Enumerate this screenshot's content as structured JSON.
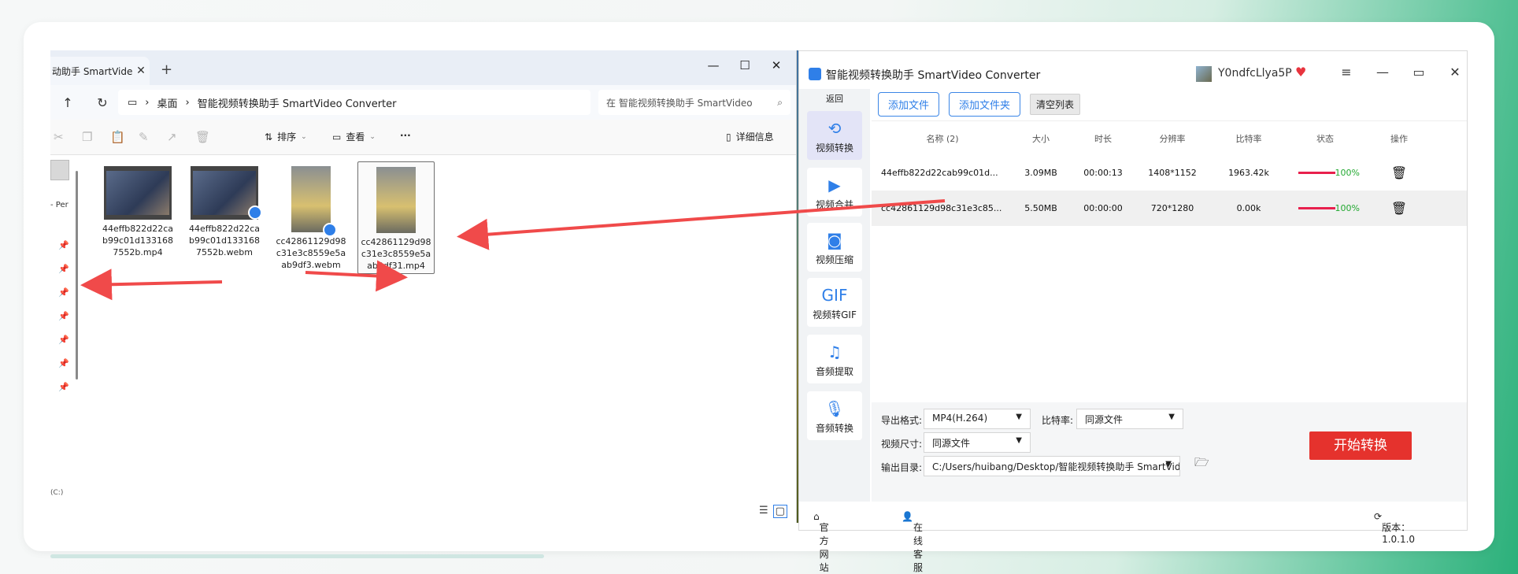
{
  "explorer": {
    "tab_title": "动助手 SmartVideo",
    "tab_close": "✕",
    "new_tab": "+",
    "window": {
      "minimize": "—",
      "maximize": "☐",
      "close": "✕"
    },
    "nav": {
      "up": "↑",
      "refresh": "↻",
      "monitor": "▭",
      "sep": "›"
    },
    "breadcrumb": [
      "桌面",
      "智能视频转换助手 SmartVideo Converter"
    ],
    "search_placeholder": "在 智能视频转换助手 SmartVideo",
    "search_icon": "⌕",
    "toolbar": {
      "sort_label": "排序",
      "view_label": "查看",
      "more_label": "···",
      "details_label": "详细信息"
    },
    "nav_fragment": "- Per",
    "drive_fragment": "(C:)",
    "files": [
      {
        "name": "44effb822d22cab99c01d1331687552b.mp4",
        "kind": "wide",
        "badge": false,
        "selected": false
      },
      {
        "name": "44effb822d22cab99c01d1331687552b.webm",
        "kind": "wide",
        "badge": true,
        "selected": false
      },
      {
        "name": "cc42861129d98c31e3c8559e5aab9df3.webm",
        "kind": "tall",
        "badge": true,
        "selected": false
      },
      {
        "name": "cc42861129d98c31e3c8559e5aab9df31.mp4",
        "kind": "tall",
        "badge": false,
        "selected": true
      }
    ],
    "view_icons": {
      "list": "☰",
      "grid": "▢"
    }
  },
  "app": {
    "title": "智能视频转换助手 SmartVideo Converter",
    "username": "Y0ndfcLlya5P",
    "vip_icon": "♥",
    "controls": {
      "menu": "≡",
      "minimize": "—",
      "maximize": "▭",
      "close": "✕"
    },
    "sidebar": {
      "back": "返回",
      "items": [
        {
          "label": "视频转换",
          "icon": "⟲",
          "active": true
        },
        {
          "label": "视频合并",
          "icon": "▶",
          "active": false
        },
        {
          "label": "视频压缩",
          "icon": "◙",
          "active": false
        },
        {
          "label": "视频转GIF",
          "icon": "GIF",
          "active": false
        },
        {
          "label": "音频提取",
          "icon": "♫",
          "active": false
        },
        {
          "label": "音频转换",
          "icon": "🎙",
          "active": false
        }
      ]
    },
    "actions": {
      "add_file": "添加文件",
      "add_folder": "添加文件夹",
      "clear_list": "清空列表"
    },
    "table": {
      "headers": {
        "name": "名称 (2)",
        "size": "大小",
        "duration": "时长",
        "resolution": "分辨率",
        "bitrate": "比特率",
        "status": "状态",
        "op": "操作"
      },
      "rows": [
        {
          "name": "44effb822d22cab99c01d...",
          "size": "3.09MB",
          "duration": "00:00:13",
          "resolution": "1408*1152",
          "bitrate": "1963.42k",
          "progress": "100%"
        },
        {
          "name": "cc42861129d98c31e3c85...",
          "size": "5.50MB",
          "duration": "00:00:00",
          "resolution": "720*1280",
          "bitrate": "0.00k",
          "progress": "100%"
        }
      ],
      "delete_icon": "🗑"
    },
    "settings": {
      "format_label": "导出格式:",
      "format_value": "MP4(H.264)",
      "bitrate_label": "比特率:",
      "bitrate_value": "同源文件",
      "size_label": "视频尺寸:",
      "size_value": "同源文件",
      "output_label": "输出目录:",
      "output_value": "C:/Users/huibang/Desktop/智能视频转换助手 SmartVideo",
      "folder_icon": "🗁",
      "start_label": "开始转换"
    },
    "footer": {
      "website": "官方网站",
      "support": "在线客服",
      "version": "版本：1.0.1.0"
    },
    "colors": {
      "accent": "#2f7fe8",
      "start": "#e5322d",
      "progress": "#e8204d",
      "done": "#22a830"
    }
  }
}
